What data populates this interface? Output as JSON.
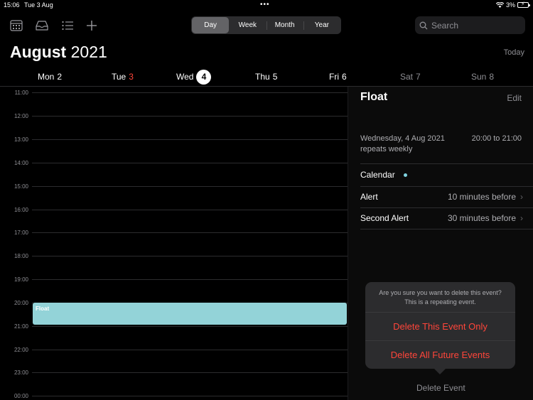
{
  "status_bar": {
    "time": "15:06",
    "date": "Tue 3 Aug",
    "battery": "3%"
  },
  "toolbar": {
    "view_modes": [
      "Day",
      "Week",
      "Month",
      "Year"
    ],
    "active_view": "Day",
    "search_placeholder": "Search"
  },
  "header": {
    "month": "August",
    "year": "2021",
    "today_label": "Today"
  },
  "week": [
    {
      "name": "Mon",
      "num": "2"
    },
    {
      "name": "Tue",
      "num": "3"
    },
    {
      "name": "Wed",
      "num": "4"
    },
    {
      "name": "Thu",
      "num": "5"
    },
    {
      "name": "Fri",
      "num": "6"
    },
    {
      "name": "Sat",
      "num": "7"
    },
    {
      "name": "Sun",
      "num": "8"
    }
  ],
  "hours": [
    "11:00",
    "12:00",
    "13:00",
    "14:00",
    "15:00",
    "16:00",
    "17:00",
    "18:00",
    "19:00",
    "20:00",
    "21:00",
    "22:00",
    "23:00",
    "00:00"
  ],
  "event": {
    "title": "Float",
    "color": "#93d3d8"
  },
  "detail": {
    "title": "Float",
    "edit_label": "Edit",
    "date": "Wednesday, 4 Aug 2021",
    "repeat": "repeats weekly",
    "time_range": "20:00 to 21:00",
    "calendar_label": "Calendar",
    "calendar_color": "#7fd3e0",
    "alert_label": "Alert",
    "alert_value": "10 minutes before",
    "second_alert_label": "Second Alert",
    "second_alert_value": "30 minutes before",
    "delete_label": "Delete Event"
  },
  "popover": {
    "message_line1": "Are you sure you want to delete this event?",
    "message_line2": "This is a repeating event.",
    "option_one": "Delete This Event Only",
    "option_all": "Delete All Future Events"
  }
}
